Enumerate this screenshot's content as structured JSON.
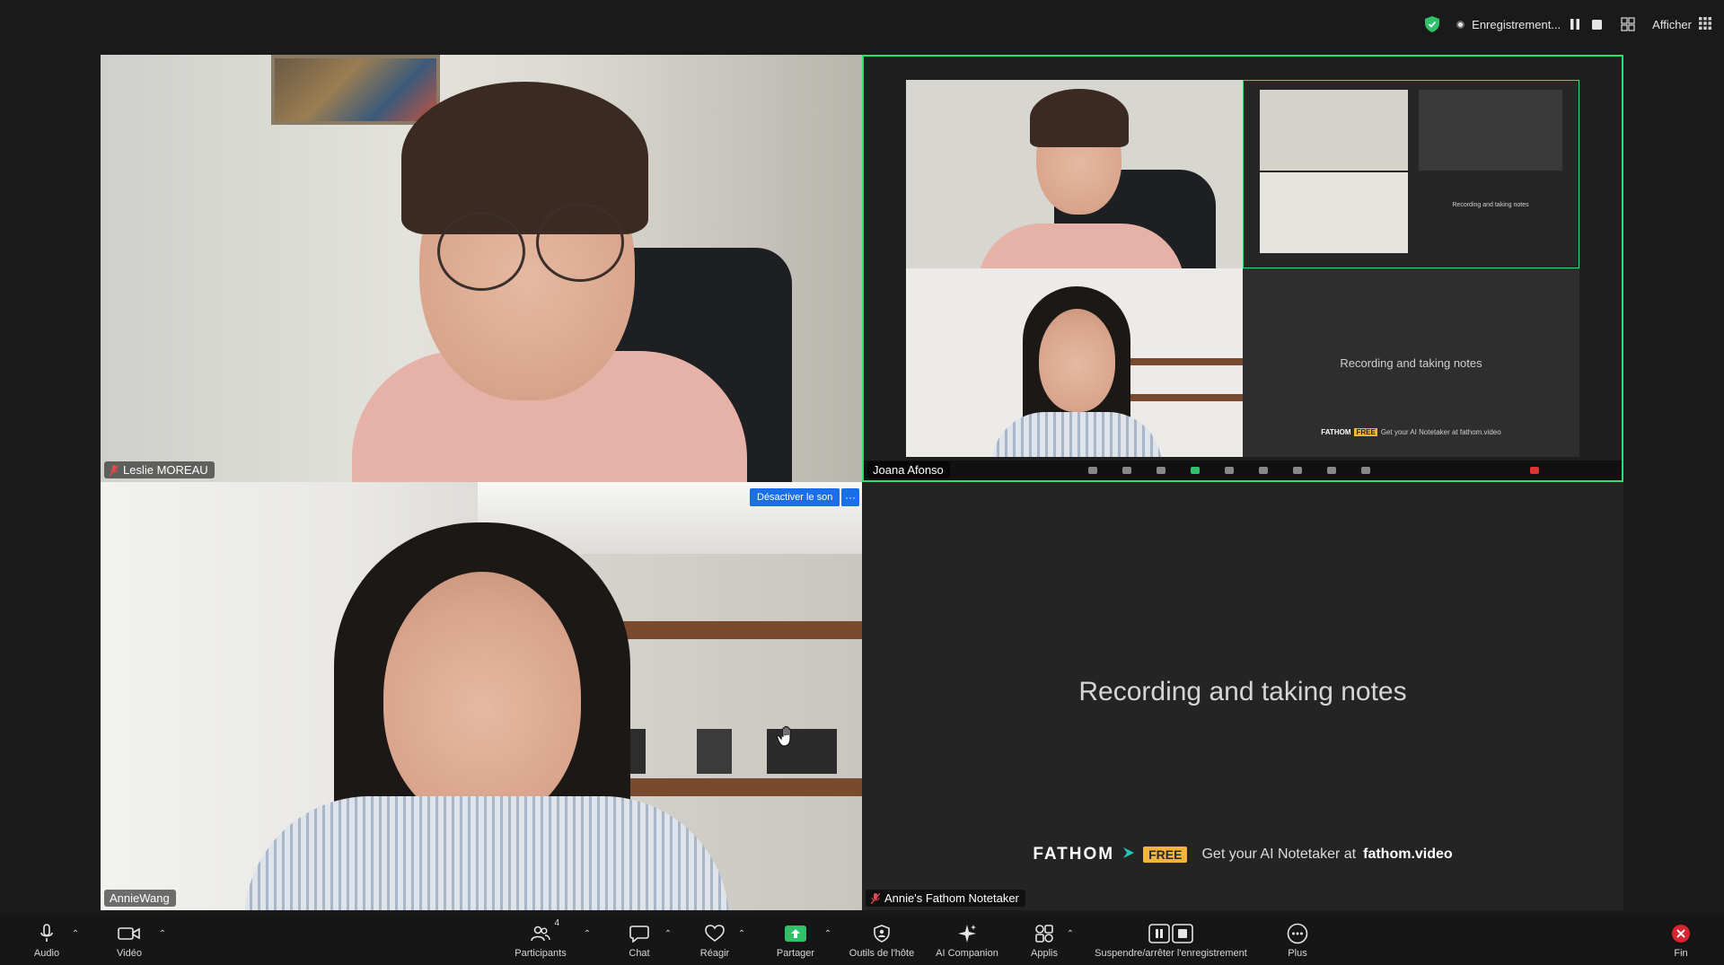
{
  "topbar": {
    "recording_label": "Enregistrement...",
    "view_label": "Afficher"
  },
  "participants": [
    {
      "name": "Leslie MOREAU"
    },
    {
      "name": "Joana Afonso"
    },
    {
      "name": "AnnieWang"
    },
    {
      "name": "Annie's Fathom Notetaker"
    }
  ],
  "overlay": {
    "unmute_label": "Désactiver le son",
    "more_label": "···"
  },
  "fathom": {
    "status_text": "Recording and taking notes",
    "logo_text": "FATHOM",
    "badge": "FREE",
    "promo_text": "Get your AI Notetaker at",
    "promo_link": "fathom.video"
  },
  "share_preview": {
    "status_text": "Recording and taking notes",
    "logo_text": "FATHOM",
    "badge": "FREE",
    "promo_text": "Get your AI Notetaker at fathom.video"
  },
  "toolbar": {
    "audio": "Audio",
    "video": "Vidéo",
    "participants": "Participants",
    "participants_count": "4",
    "chat": "Chat",
    "react": "Réagir",
    "share": "Partager",
    "host_tools": "Outils de l'hôte",
    "ai_companion": "AI Companion",
    "apps": "Applis",
    "record": "Suspendre/arrêter l'enregistrement",
    "more": "Plus",
    "end": "Fin"
  },
  "colors": {
    "active_speaker": "#2ee071",
    "share_green": "#2ec26a",
    "unmute_blue": "#1a6ee8",
    "end_red": "#d7232f",
    "fathom_badge": "#f2b53a"
  }
}
